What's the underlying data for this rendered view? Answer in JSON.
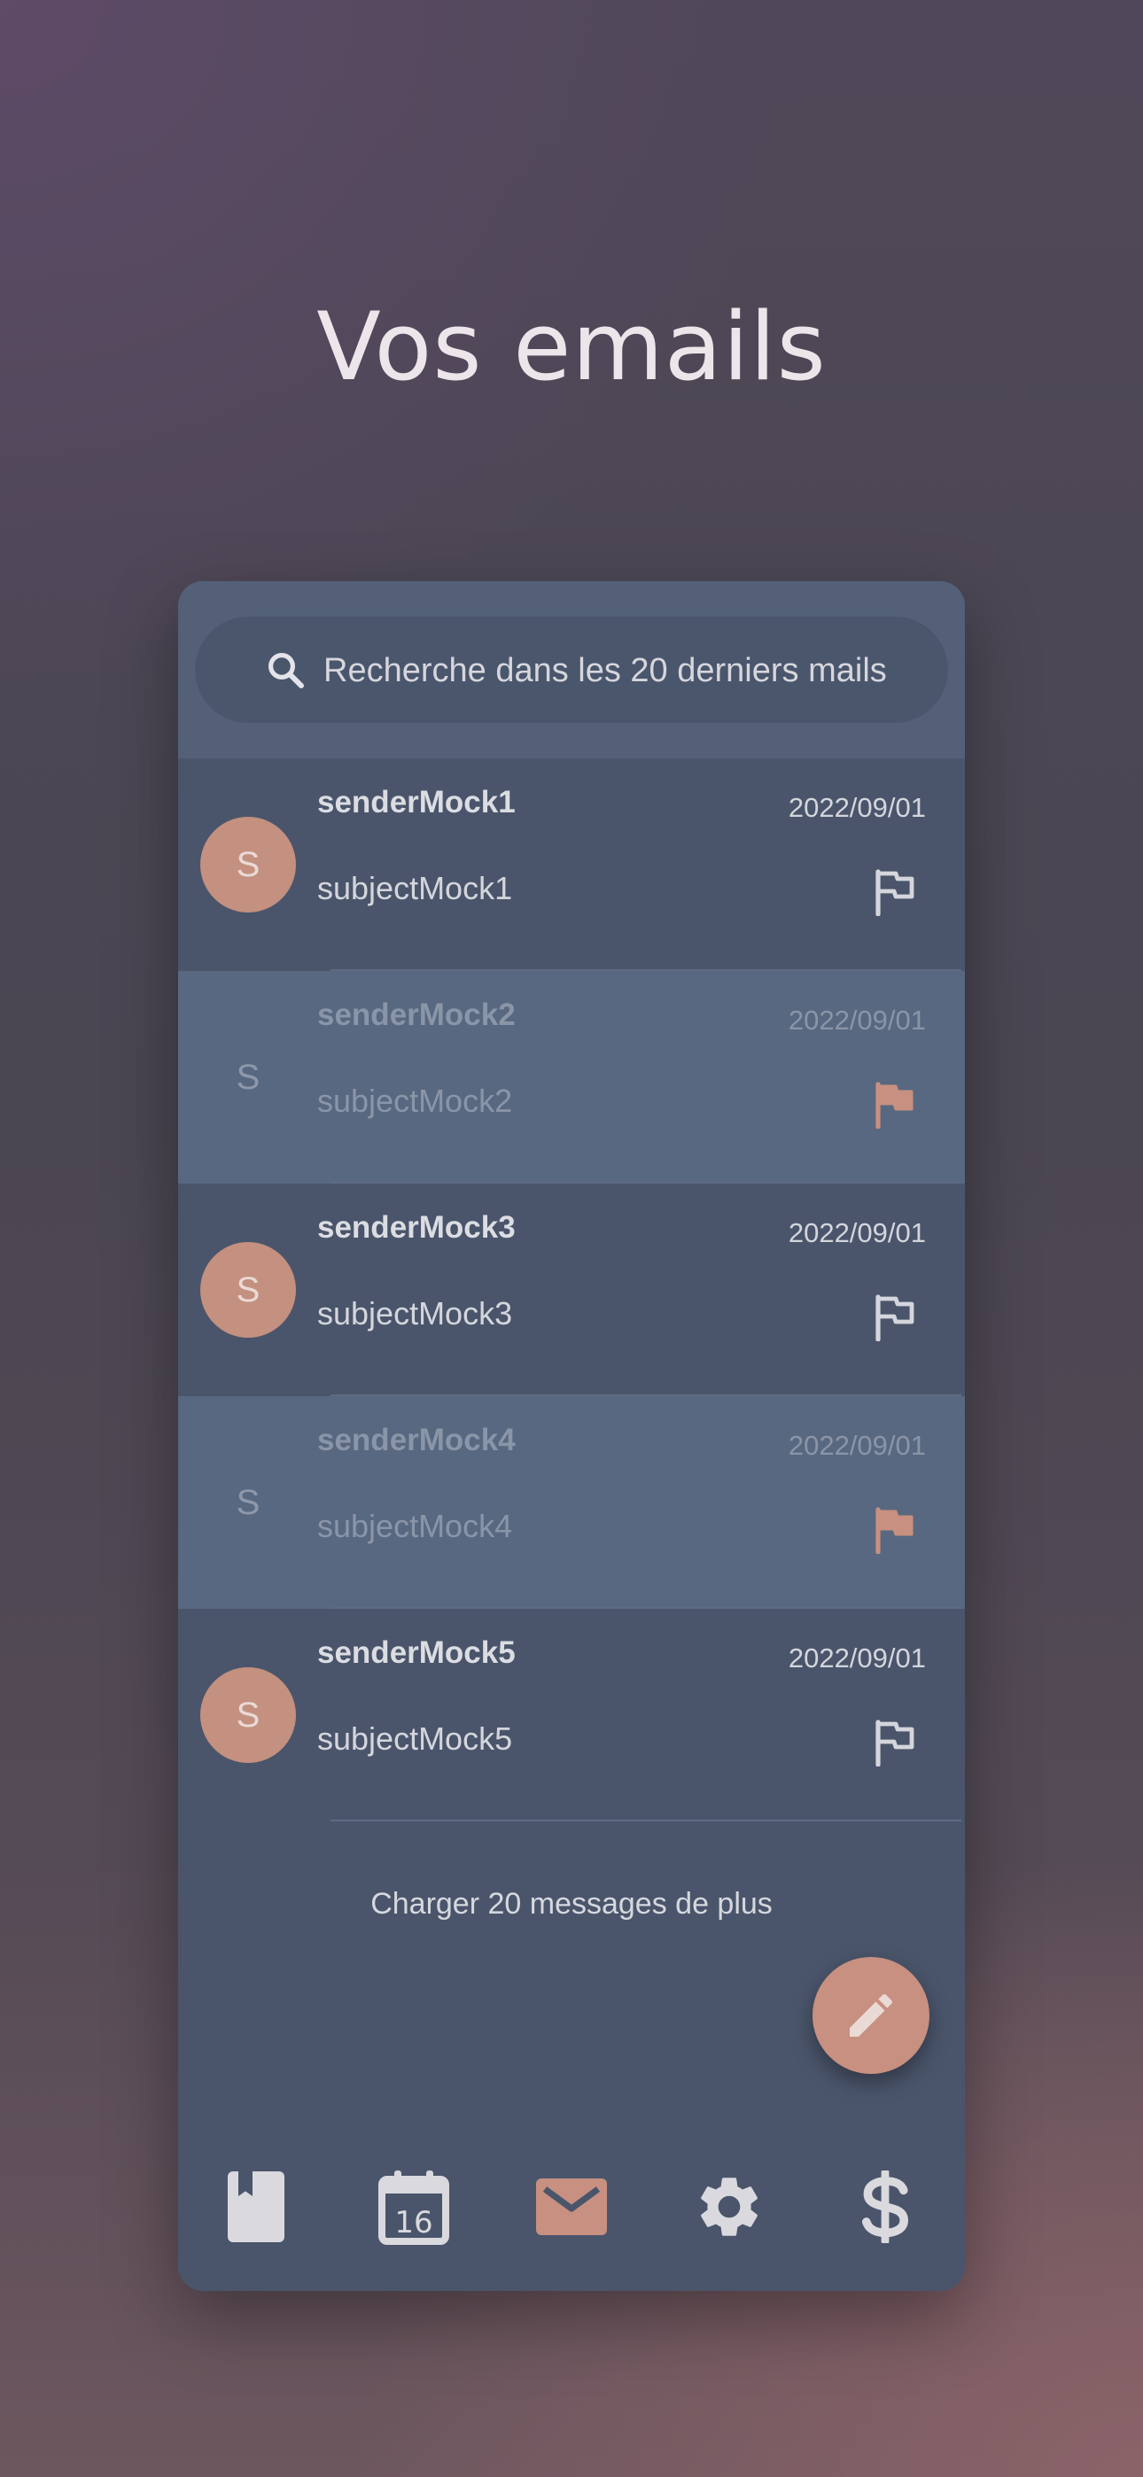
{
  "page": {
    "title": "Vos emails"
  },
  "search": {
    "placeholder": "Recherche dans les 20 derniers mails"
  },
  "emails": [
    {
      "avatar_letter": "S",
      "sender": "senderMock1",
      "date": "2022/09/01",
      "subject": "subjectMock1",
      "flagged": false,
      "read": false
    },
    {
      "avatar_letter": "S",
      "sender": "senderMock2",
      "date": "2022/09/01",
      "subject": "subjectMock2",
      "flagged": true,
      "read": true
    },
    {
      "avatar_letter": "S",
      "sender": "senderMock3",
      "date": "2022/09/01",
      "subject": "subjectMock3",
      "flagged": false,
      "read": false
    },
    {
      "avatar_letter": "S",
      "sender": "senderMock4",
      "date": "2022/09/01",
      "subject": "subjectMock4",
      "flagged": true,
      "read": true
    },
    {
      "avatar_letter": "S",
      "sender": "senderMock5",
      "date": "2022/09/01",
      "subject": "subjectMock5",
      "flagged": false,
      "read": false
    }
  ],
  "list": {
    "load_more_label": "Charger 20 messages de plus"
  },
  "fab": {
    "icon": "pencil-icon"
  },
  "bottom_nav": {
    "items": [
      {
        "icon": "contact-book-icon",
        "active": false
      },
      {
        "icon": "calendar-icon",
        "calendar_day": "16",
        "active": false
      },
      {
        "icon": "mail-icon",
        "active": true
      },
      {
        "icon": "gear-icon",
        "active": false
      },
      {
        "icon": "dollar-icon",
        "active": false
      }
    ]
  },
  "colors": {
    "accent": "#c89080",
    "card": "#4a556b",
    "read_row": "#586880",
    "icon_muted": "#d4d6dc"
  }
}
